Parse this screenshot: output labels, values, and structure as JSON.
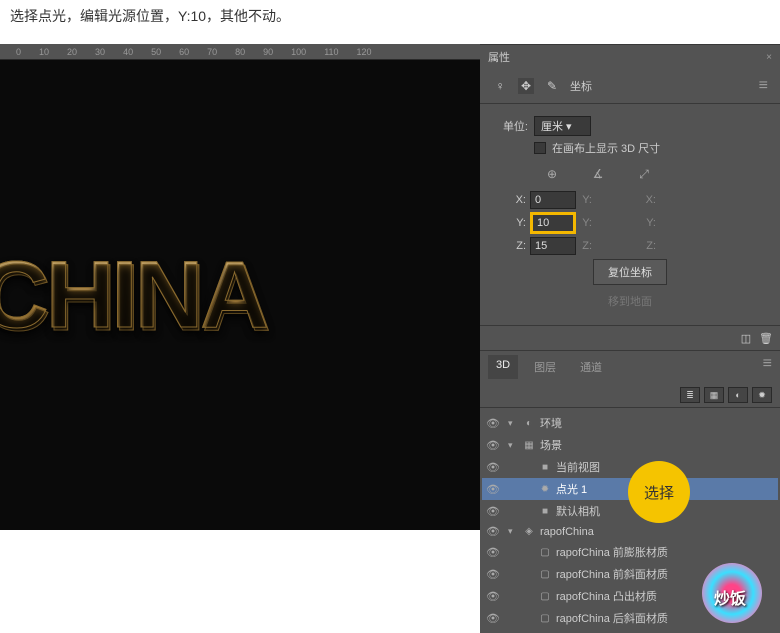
{
  "instruction": "选择点光，编辑光源位置，Y:10，其他不动。",
  "ruler_marks": [
    "0",
    "10",
    "20",
    "30",
    "40",
    "50",
    "60",
    "70",
    "80",
    "90",
    "100",
    "110",
    "120"
  ],
  "canvas_text": "CHINA",
  "properties": {
    "title": "属性",
    "coord_tab": "坐标",
    "unit_label": "单位:",
    "unit_value": "厘米",
    "show_3d_label": "在画布上显示 3D 尺寸",
    "x": {
      "label": "X:",
      "val": "0",
      "g1_label": "Y:",
      "g1": "",
      "g2_label": "X:",
      "g2": ""
    },
    "y": {
      "label": "Y:",
      "val": "10",
      "g1_label": "Y:",
      "g1": "",
      "g2_label": "Y:",
      "g2": ""
    },
    "z": {
      "label": "Z:",
      "val": "15",
      "g1_label": "Z:",
      "g1": "",
      "g2_label": "Z:",
      "g2": ""
    },
    "reset_btn": "复位坐标",
    "move_ground_btn": "移到地面"
  },
  "layers_panel": {
    "tabs": [
      "3D",
      "图层",
      "通道"
    ],
    "active_tab": 0,
    "tree": [
      {
        "eye": true,
        "depth": 0,
        "expand": "▾",
        "icon": "◐",
        "label": "环境"
      },
      {
        "eye": true,
        "depth": 0,
        "expand": "▾",
        "icon": "▦",
        "label": "场景"
      },
      {
        "eye": true,
        "depth": 1,
        "expand": "",
        "icon": "■",
        "label": "当前视图"
      },
      {
        "eye": true,
        "depth": 1,
        "expand": "",
        "icon": "✹",
        "label": "点光 1",
        "selected": true
      },
      {
        "eye": true,
        "depth": 1,
        "expand": "",
        "icon": "■",
        "label": "默认相机"
      },
      {
        "eye": true,
        "depth": 0,
        "expand": "▾",
        "icon": "◈",
        "label": "rapofChina"
      },
      {
        "eye": true,
        "depth": 1,
        "expand": "",
        "icon": "▢",
        "label": "rapofChina 前膨胀材质"
      },
      {
        "eye": true,
        "depth": 1,
        "expand": "",
        "icon": "▢",
        "label": "rapofChina 前斜面材质"
      },
      {
        "eye": true,
        "depth": 1,
        "expand": "",
        "icon": "▢",
        "label": "rapofChina 凸出材质"
      },
      {
        "eye": true,
        "depth": 1,
        "expand": "",
        "icon": "▢",
        "label": "rapofChina 后斜面材质"
      }
    ]
  },
  "badge_text": "选择"
}
